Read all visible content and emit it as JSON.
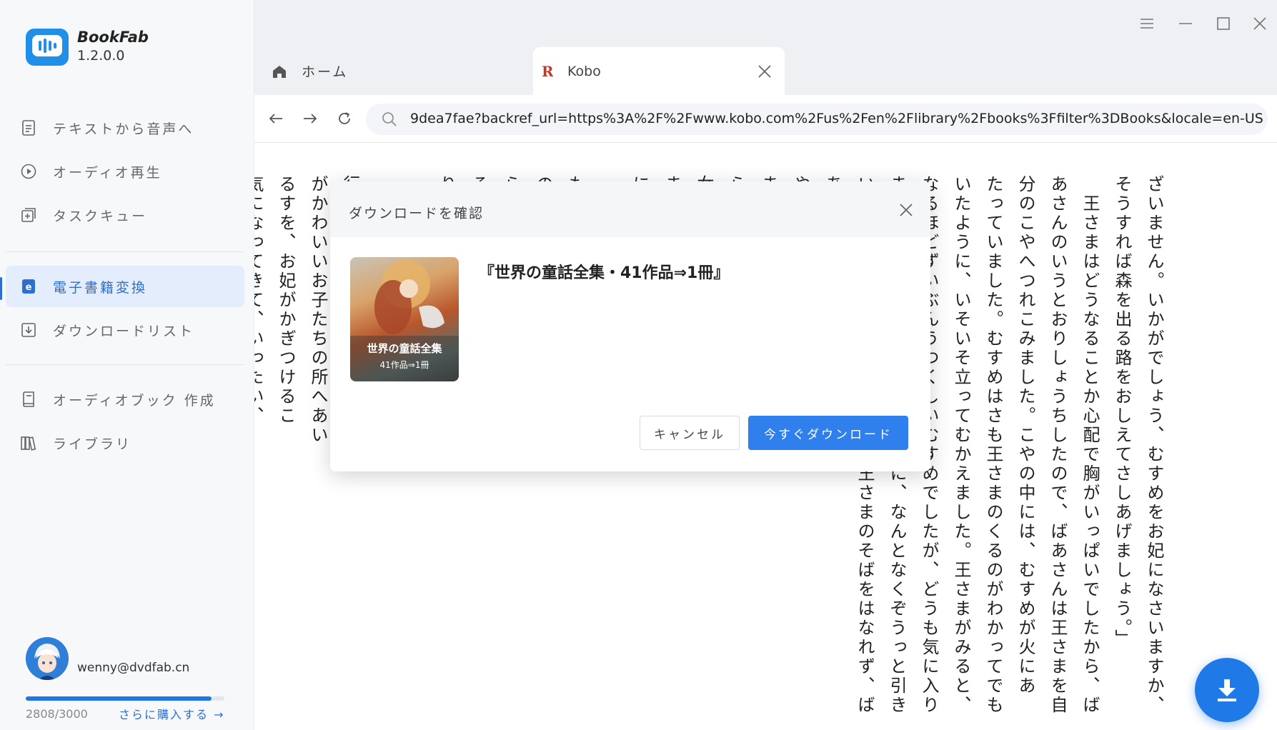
{
  "app": {
    "name": "BookFab",
    "version": "1.2.0.0"
  },
  "sidebar": {
    "items": [
      {
        "label": "テキストから音声へ",
        "icon": "document-text-icon"
      },
      {
        "label": "オーディオ再生",
        "icon": "play-circle-icon"
      },
      {
        "label": "タスクキュー",
        "icon": "task-queue-icon"
      },
      {
        "label": "電子書籍変換",
        "icon": "ebook-icon",
        "active": true
      },
      {
        "label": "ダウンロードリスト",
        "icon": "download-list-icon"
      },
      {
        "label": "オーディオブック 作成",
        "icon": "audiobook-icon"
      },
      {
        "label": "ライブラリ",
        "icon": "library-icon"
      }
    ]
  },
  "account": {
    "email": "wenny@dvdfab.cn",
    "quota_text": "2808/3000",
    "quota_fraction": 0.936,
    "buy_more": "さらに購入する →"
  },
  "tabs": [
    {
      "label": "ホーム",
      "icon": "home-icon"
    },
    {
      "label": "Kobo",
      "icon": "kobo-icon",
      "active": true
    }
  ],
  "address": {
    "url": "9dea7fae?backref_url=https%3A%2F%2Fwww.kobo.com%2Fus%2Fen%2Flibrary%2Fbooks%3Ffilter%3DBooks&locale=en-US"
  },
  "page": {
    "text": "ざいません。いかがでしょう、むすめをお妃になさいますか、\nそうすれば森を出る路をおしえてさしあげましょう。」\n　王さまはどうなることか心配で胸がいっぱいでしたから、ば\nあさんのいうとおりしょうちしたので、ばあさんは王さまを自\n分のこやへつれこみました。こやの中には、むすめが火にあ\nたっていました。むすめはさも王さまのくるのがわかってでも\nいたように、いそいそ立ってむかえました。王さまがみると、\nなるほどずいぶんうつくしいむすめでしたが、どうも気に入り\nませんでした。顔をみているうちに、なんとなくぞうっと引き\nいれました。それでもむすめは、王さまのそばをはなれず、ば\nあさんははじめて王さまに路\nやっとお城にかえれたので、\nました。\nら後、結婚なさったことがあっ\n女の子がひとり、つごう七人\nまは、世界じゅうのどんなも\nにしていました。で、こうな\n　こどもたちにやさしくしな\nもされてはときづかって、森\nのなかに、お子たちをつれて\nらないようになっていて、お\nるのがとてもむずかしく、王\nりません。それを教わるの\n　ふしぎなきどくをもつおだ\n　このおだまきは前になげる\n行って、路を教えてくれまし\nがかわいいお子たちの所へあい\nるすを、お妃がかぎつけるこ\n気になってきて、いったい、\nなにをしに出かけるのか、知\nこでお妃は、王さまのけらい"
  },
  "modal": {
    "title": "ダウンロードを確認",
    "book_title": "『世界の童話全集・41作品⇒1冊』",
    "cover_line1": "世界の童話全集",
    "cover_line2": "41作品⇒1冊",
    "cancel_label": "キャンセル",
    "download_label": "今すぐダウンロード"
  },
  "colors": {
    "accent": "#2f80ed",
    "active_nav_bg": "#e3edfb",
    "sidebar_bg": "#f7f8fa",
    "tabbar_bg": "#eef0f3"
  }
}
